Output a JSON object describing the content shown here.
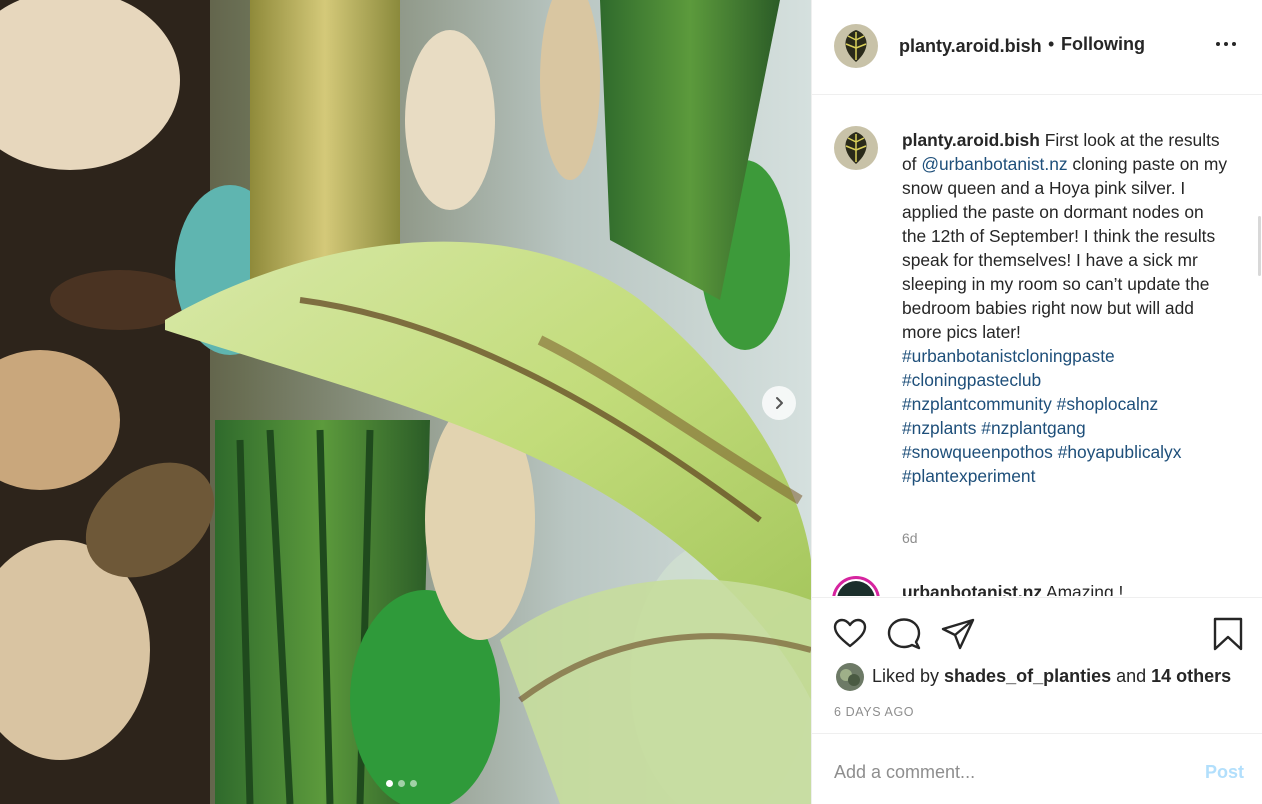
{
  "post": {
    "username": "planty.aroid.bish",
    "separator": "•",
    "follow_status": "Following",
    "more_icon": "more-horizontal-icon"
  },
  "media": {
    "next_icon": "chevron-right-icon",
    "slides_total": 3,
    "active_slide": 1
  },
  "caption": {
    "username": "planty.aroid.bish",
    "text_1": " First look at the results of ",
    "mention": "@urbanbotanist.nz",
    "text_2": " cloning paste on my snow queen and a Hoya pink silver. I applied the paste on dormant nodes on the 12th of September! I think the results speak for themselves! I have a sick mr sleeping in my room so can’t update the bedroom babies right now but will add more pics later!",
    "hashtags": [
      "#urbanbotanistcloningpaste",
      "#cloningpasteclub",
      "#nzplantcommunity",
      "#shoplocalnz",
      "#nzplants",
      "#nzplantgang",
      "#snowqueenpothos",
      "#hoyapublicalyx",
      "#plantexperiment"
    ],
    "age": "6d"
  },
  "comment": {
    "username": "urbanbotanist.nz",
    "text": " Amazing !"
  },
  "actions": {
    "like_icon": "heart-icon",
    "comment_icon": "comment-icon",
    "share_icon": "share-icon",
    "save_icon": "bookmark-icon"
  },
  "likes": {
    "prefix": "Liked by ",
    "user": "shades_of_planties",
    "middle": " and ",
    "others": "14 others"
  },
  "date": "6 DAYS AGO",
  "add_comment": {
    "placeholder": "Add a comment...",
    "post_label": "Post",
    "post_color": "#b2dffc"
  },
  "colors": {
    "link": "#1e4f7a",
    "muted": "#8e8e8e",
    "story_ring": "#d6249f"
  }
}
